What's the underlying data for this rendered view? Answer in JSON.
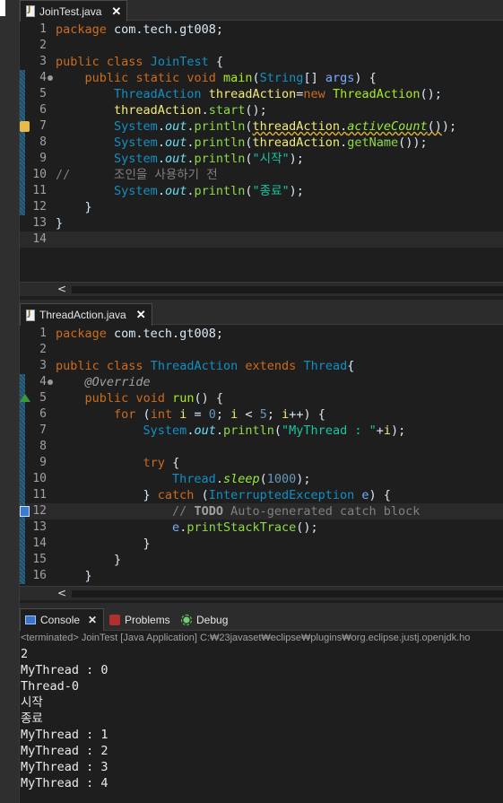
{
  "editor1": {
    "tab_label": "JoinTest.java",
    "close_glyph": "✕",
    "lines": [
      [
        {
          "c": "k",
          "t": "package"
        },
        {
          "c": "pl",
          "t": " com.tech.gt008;"
        }
      ],
      [],
      [
        {
          "c": "k",
          "t": "public"
        },
        {
          "c": "pl",
          "t": " "
        },
        {
          "c": "k",
          "t": "class"
        },
        {
          "c": "pl",
          "t": " "
        },
        {
          "c": "t",
          "t": "JoinTest"
        },
        {
          "c": "pl",
          "t": " {"
        }
      ],
      [
        {
          "c": "pl",
          "t": "    "
        },
        {
          "c": "k",
          "t": "public"
        },
        {
          "c": "pl",
          "t": " "
        },
        {
          "c": "k",
          "t": "static"
        },
        {
          "c": "pl",
          "t": " "
        },
        {
          "c": "k",
          "t": "void"
        },
        {
          "c": "pl",
          "t": " "
        },
        {
          "c": "m",
          "t": "main"
        },
        {
          "c": "pl",
          "t": "("
        },
        {
          "c": "t",
          "t": "String"
        },
        {
          "c": "pl",
          "t": "[] "
        },
        {
          "c": "p",
          "t": "args"
        },
        {
          "c": "pl",
          "t": ") {"
        }
      ],
      [
        {
          "c": "pl",
          "t": "        "
        },
        {
          "c": "t",
          "t": "ThreadAction"
        },
        {
          "c": "pl",
          "t": " "
        },
        {
          "c": "v",
          "t": "threadAction"
        },
        {
          "c": "op",
          "t": "="
        },
        {
          "c": "k",
          "t": "new"
        },
        {
          "c": "pl",
          "t": " "
        },
        {
          "c": "m",
          "t": "ThreadAction"
        },
        {
          "c": "pl",
          "t": "();"
        }
      ],
      [
        {
          "c": "pl",
          "t": "        "
        },
        {
          "c": "v",
          "t": "threadAction"
        },
        {
          "c": "pl",
          "t": "."
        },
        {
          "c": "so",
          "t": "start"
        },
        {
          "c": "pl",
          "t": "();"
        }
      ],
      [
        {
          "c": "pl",
          "t": "        "
        },
        {
          "c": "t",
          "t": "System"
        },
        {
          "c": "pl",
          "t": "."
        },
        {
          "c": "fi",
          "t": "out"
        },
        {
          "c": "pl",
          "t": "."
        },
        {
          "c": "f",
          "t": "println"
        },
        {
          "c": "pl",
          "t": "("
        },
        {
          "c": "v wavy",
          "t": "threadAction"
        },
        {
          "c": "pl wavy",
          "t": "."
        },
        {
          "c": "sm wavy",
          "t": "activeCount"
        },
        {
          "c": "pl wavy",
          "t": "()"
        },
        {
          "c": "pl",
          "t": ");"
        }
      ],
      [
        {
          "c": "pl",
          "t": "        "
        },
        {
          "c": "t",
          "t": "System"
        },
        {
          "c": "pl",
          "t": "."
        },
        {
          "c": "fi",
          "t": "out"
        },
        {
          "c": "pl",
          "t": "."
        },
        {
          "c": "f",
          "t": "println"
        },
        {
          "c": "pl",
          "t": "("
        },
        {
          "c": "v",
          "t": "threadAction"
        },
        {
          "c": "pl",
          "t": "."
        },
        {
          "c": "f",
          "t": "getName"
        },
        {
          "c": "pl",
          "t": "());"
        }
      ],
      [
        {
          "c": "pl",
          "t": "        "
        },
        {
          "c": "t",
          "t": "System"
        },
        {
          "c": "pl",
          "t": "."
        },
        {
          "c": "fi",
          "t": "out"
        },
        {
          "c": "pl",
          "t": "."
        },
        {
          "c": "f",
          "t": "println"
        },
        {
          "c": "pl",
          "t": "("
        },
        {
          "c": "s",
          "t": "\"시작\""
        },
        {
          "c": "pl",
          "t": ");"
        }
      ],
      [
        {
          "c": "c",
          "t": "//      조인을 사용하기 전"
        }
      ],
      [
        {
          "c": "pl",
          "t": "        "
        },
        {
          "c": "t",
          "t": "System"
        },
        {
          "c": "pl",
          "t": "."
        },
        {
          "c": "fi",
          "t": "out"
        },
        {
          "c": "pl",
          "t": "."
        },
        {
          "c": "f",
          "t": "println"
        },
        {
          "c": "pl",
          "t": "("
        },
        {
          "c": "s",
          "t": "\"종료\""
        },
        {
          "c": "pl",
          "t": ");"
        }
      ],
      [
        {
          "c": "pl",
          "t": "    }"
        }
      ],
      [
        {
          "c": "pl",
          "t": "}"
        }
      ],
      []
    ]
  },
  "editor2": {
    "tab_label": "ThreadAction.java",
    "close_glyph": "✕",
    "lines": [
      [
        {
          "c": "k",
          "t": "package"
        },
        {
          "c": "pl",
          "t": " com.tech.gt008;"
        }
      ],
      [],
      [
        {
          "c": "k",
          "t": "public"
        },
        {
          "c": "pl",
          "t": " "
        },
        {
          "c": "k",
          "t": "class"
        },
        {
          "c": "pl",
          "t": " "
        },
        {
          "c": "t",
          "t": "ThreadAction"
        },
        {
          "c": "pl",
          "t": " "
        },
        {
          "c": "k",
          "t": "extends"
        },
        {
          "c": "pl",
          "t": " "
        },
        {
          "c": "t",
          "t": "Thread"
        },
        {
          "c": "pl",
          "t": "{"
        }
      ],
      [
        {
          "c": "pl",
          "t": "    "
        },
        {
          "c": "an",
          "t": "@Override"
        }
      ],
      [
        {
          "c": "pl",
          "t": "    "
        },
        {
          "c": "k",
          "t": "public"
        },
        {
          "c": "pl",
          "t": " "
        },
        {
          "c": "k",
          "t": "void"
        },
        {
          "c": "pl",
          "t": " "
        },
        {
          "c": "m",
          "t": "run"
        },
        {
          "c": "pl",
          "t": "() {"
        }
      ],
      [
        {
          "c": "pl",
          "t": "        "
        },
        {
          "c": "k",
          "t": "for"
        },
        {
          "c": "pl",
          "t": " ("
        },
        {
          "c": "k",
          "t": "int"
        },
        {
          "c": "pl",
          "t": " "
        },
        {
          "c": "v",
          "t": "i"
        },
        {
          "c": "pl",
          "t": " = "
        },
        {
          "c": "n",
          "t": "0"
        },
        {
          "c": "pl",
          "t": "; "
        },
        {
          "c": "v",
          "t": "i"
        },
        {
          "c": "pl",
          "t": " < "
        },
        {
          "c": "n",
          "t": "5"
        },
        {
          "c": "pl",
          "t": "; "
        },
        {
          "c": "v",
          "t": "i"
        },
        {
          "c": "pl",
          "t": "++) {"
        }
      ],
      [
        {
          "c": "pl",
          "t": "            "
        },
        {
          "c": "t",
          "t": "System"
        },
        {
          "c": "pl",
          "t": "."
        },
        {
          "c": "fi",
          "t": "out"
        },
        {
          "c": "pl",
          "t": "."
        },
        {
          "c": "f",
          "t": "println"
        },
        {
          "c": "pl",
          "t": "("
        },
        {
          "c": "s",
          "t": "\"MyThread : \""
        },
        {
          "c": "pl",
          "t": "+"
        },
        {
          "c": "v",
          "t": "i"
        },
        {
          "c": "pl",
          "t": ");"
        }
      ],
      [],
      [
        {
          "c": "pl",
          "t": "            "
        },
        {
          "c": "k",
          "t": "try"
        },
        {
          "c": "pl",
          "t": " {"
        }
      ],
      [
        {
          "c": "pl",
          "t": "                "
        },
        {
          "c": "t",
          "t": "Thread"
        },
        {
          "c": "pl",
          "t": "."
        },
        {
          "c": "sm",
          "t": "sleep"
        },
        {
          "c": "pl",
          "t": "("
        },
        {
          "c": "n",
          "t": "1000"
        },
        {
          "c": "pl",
          "t": ");"
        }
      ],
      [
        {
          "c": "pl",
          "t": "            } "
        },
        {
          "c": "k",
          "t": "catch"
        },
        {
          "c": "pl",
          "t": " ("
        },
        {
          "c": "t",
          "t": "InterruptedException"
        },
        {
          "c": "pl",
          "t": " "
        },
        {
          "c": "p",
          "t": "e"
        },
        {
          "c": "pl",
          "t": ") {"
        }
      ],
      [
        {
          "c": "pl",
          "t": "                "
        },
        {
          "c": "c",
          "t": "// "
        },
        {
          "c": "td",
          "t": "TODO"
        },
        {
          "c": "c",
          "t": " Auto-generated catch block"
        }
      ],
      [
        {
          "c": "pl",
          "t": "                "
        },
        {
          "c": "p",
          "t": "e"
        },
        {
          "c": "pl",
          "t": "."
        },
        {
          "c": "f",
          "t": "printStackTrace"
        },
        {
          "c": "pl",
          "t": "();"
        }
      ],
      [
        {
          "c": "pl",
          "t": "            }"
        }
      ],
      [
        {
          "c": "pl",
          "t": "        }"
        }
      ],
      [
        {
          "c": "pl",
          "t": "    }"
        }
      ]
    ]
  },
  "scroll_arrow": "<",
  "console": {
    "tabs": [
      "Console",
      "Problems",
      "Debug"
    ],
    "close_glyph": "✕",
    "header": "<terminated> JoinTest [Java Application] C:₩23javaset₩eclipse₩plugins₩org.eclipse.justj.openjdk.ho",
    "lines": [
      "2",
      "MyThread : 0",
      "Thread-0",
      "시작",
      "종료",
      "MyThread : 1",
      "MyThread : 2",
      "MyThread : 3",
      "MyThread : 4"
    ]
  }
}
